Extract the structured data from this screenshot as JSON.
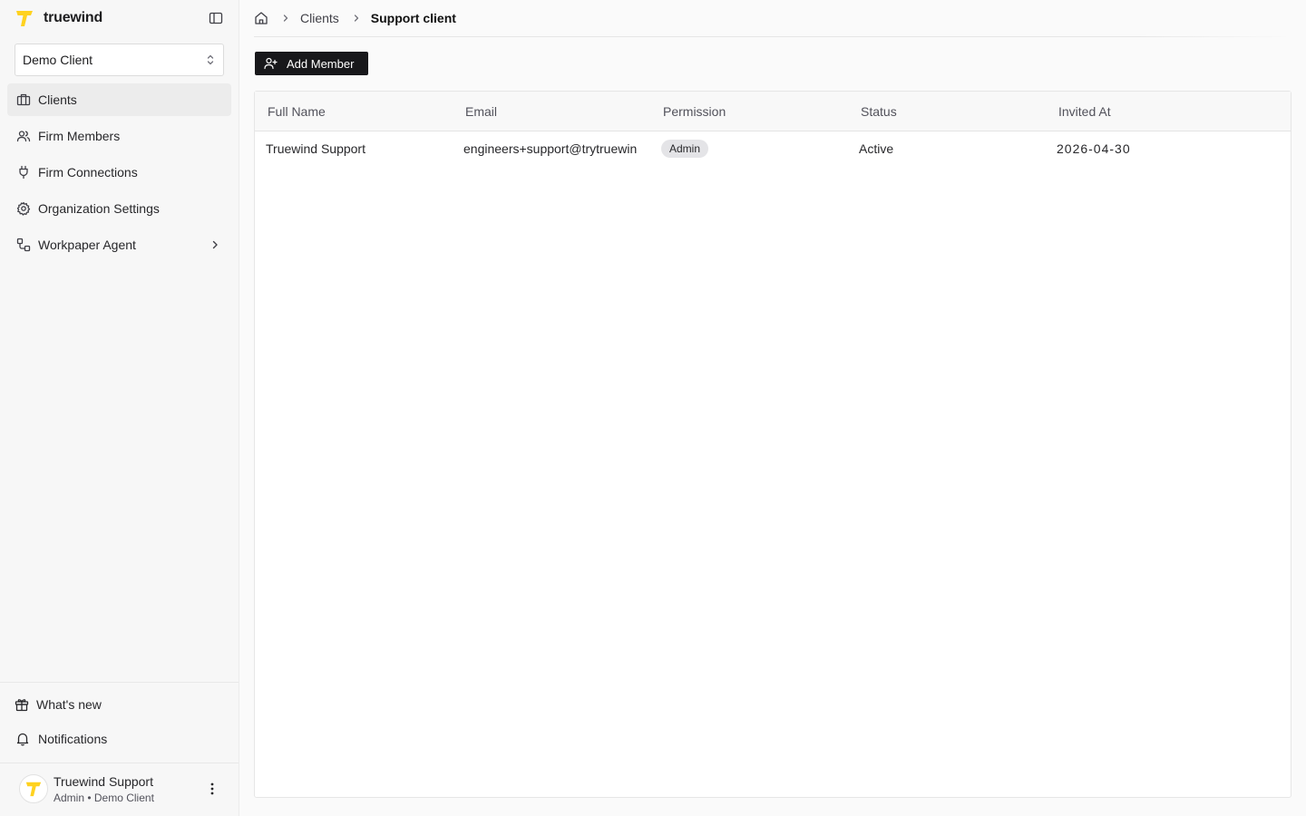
{
  "app": {
    "name": "truewind"
  },
  "client_selector": {
    "value": "Demo Client"
  },
  "sidebar": {
    "items": [
      {
        "label": "Clients",
        "icon": "building-icon",
        "active": true
      },
      {
        "label": "Firm Members",
        "icon": "users-icon"
      },
      {
        "label": "Firm Connections",
        "icon": "plug-icon"
      },
      {
        "label": "Organization Settings",
        "icon": "gear-icon"
      },
      {
        "label": "Workpaper Agent",
        "icon": "workflow-icon",
        "has_submenu": true
      }
    ],
    "bottom": {
      "whats_new": "What's new",
      "notifications": "Notifications"
    },
    "user": {
      "name": "Truewind Support",
      "role": "Admin • Demo Client"
    }
  },
  "breadcrumb": {
    "items": [
      "Clients"
    ],
    "current": "Support client"
  },
  "toolbar": {
    "add_member_label": "Add Member"
  },
  "table": {
    "columns": [
      "Full Name",
      "Email",
      "Permission",
      "Status",
      "Invited At"
    ],
    "rows": [
      {
        "full_name": "Truewind Support",
        "email": "engineers+support@trytruewin",
        "permission": "Admin",
        "status": "Active",
        "invited_at": "2026-04-30"
      }
    ]
  },
  "colors": {
    "brand_yellow": "#FFD21F",
    "primary_button": "#18181b",
    "active_nav_bg": "#ececec"
  }
}
